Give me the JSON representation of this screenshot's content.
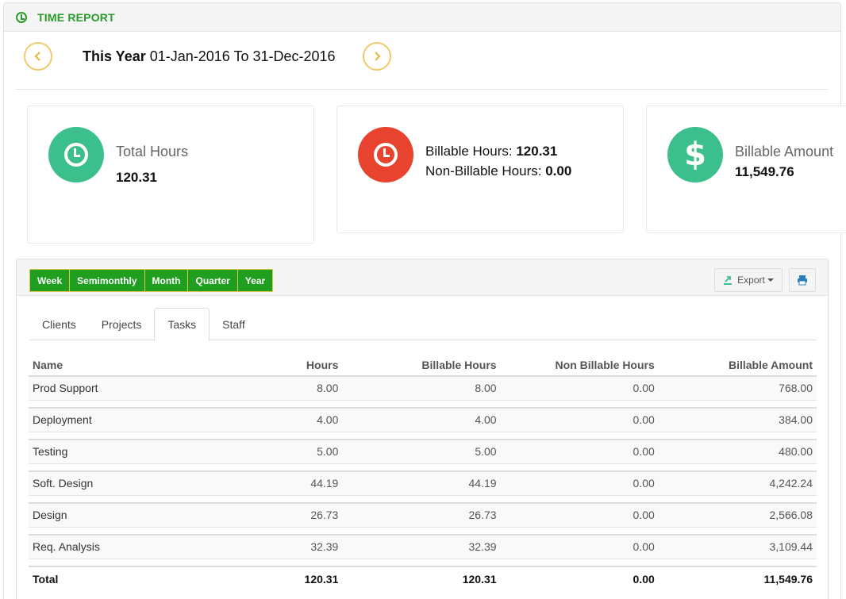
{
  "header": {
    "title": "TIME REPORT",
    "icon": "clock-icon"
  },
  "period": {
    "label": "This Year",
    "range": "01-Jan-2016 To 31-Dec-2016",
    "prev_icon": "chevron-left-icon",
    "next_icon": "chevron-right-icon"
  },
  "cards": {
    "total": {
      "label": "Total Hours",
      "value": "120.31"
    },
    "billable": {
      "billable_label": "Billable Hours:",
      "billable_value": "120.31",
      "non_billable_label": "Non-Billable Hours:",
      "non_billable_value": "0.00"
    },
    "amount": {
      "label": "Billable Amount",
      "value": "11,549.76",
      "symbol": "$"
    }
  },
  "periods": [
    "Week",
    "Semimonthly",
    "Month",
    "Quarter",
    "Year"
  ],
  "toolbar": {
    "export_label": "Export"
  },
  "tabs": [
    "Clients",
    "Projects",
    "Tasks",
    "Staff"
  ],
  "active_tab": "Tasks",
  "table": {
    "columns": [
      "Name",
      "Hours",
      "Billable Hours",
      "Non Billable Hours",
      "Billable Amount"
    ],
    "rows": [
      [
        "Prod Support",
        "8.00",
        "8.00",
        "0.00",
        "768.00"
      ],
      [
        "Deployment",
        "4.00",
        "4.00",
        "0.00",
        "384.00"
      ],
      [
        "Testing",
        "5.00",
        "5.00",
        "0.00",
        "480.00"
      ],
      [
        "Soft. Design",
        "44.19",
        "44.19",
        "0.00",
        "4,242.24"
      ],
      [
        "Design",
        "26.73",
        "26.73",
        "0.00",
        "2,566.08"
      ],
      [
        "Req. Analysis",
        "32.39",
        "32.39",
        "0.00",
        "3,109.44"
      ]
    ],
    "total": [
      "Total",
      "120.31",
      "120.31",
      "0.00",
      "11,549.76"
    ]
  },
  "colors": {
    "brand_green": "#1f9e1f",
    "teal": "#3bbf8c",
    "red": "#e8432f",
    "nav_gold": "#f0c96a"
  }
}
